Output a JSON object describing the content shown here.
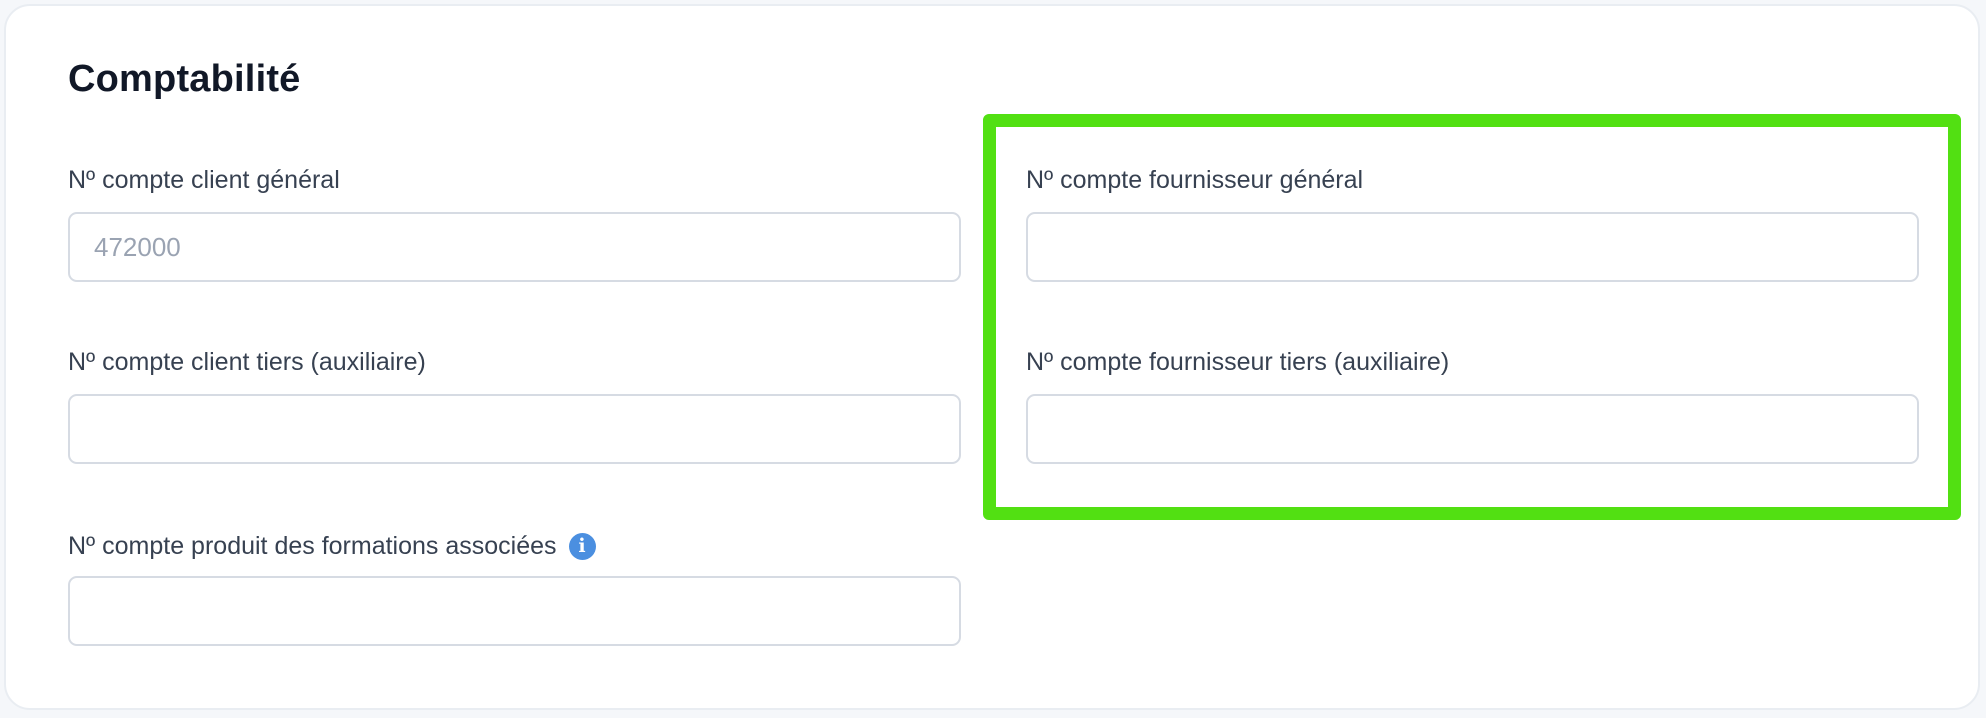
{
  "section": {
    "title": "Comptabilité"
  },
  "fields": {
    "client_general": {
      "label": "Nº compte client général",
      "value": "",
      "placeholder": "472000"
    },
    "client_tiers": {
      "label": "Nº compte client tiers (auxiliaire)",
      "value": "",
      "placeholder": ""
    },
    "produit_formations": {
      "label": "Nº compte produit des formations associées",
      "value": "",
      "placeholder": "",
      "info_icon": "info-icon"
    },
    "fournisseur_general": {
      "label": "Nº compte fournisseur général",
      "value": "",
      "placeholder": ""
    },
    "fournisseur_tiers": {
      "label": "Nº compte fournisseur tiers (auxiliaire)",
      "value": "",
      "placeholder": ""
    }
  },
  "colors": {
    "highlight": "#52e012",
    "info_icon": "#4b8fe0",
    "input_border": "#d6dbe3",
    "placeholder": "#9aa3b2"
  }
}
